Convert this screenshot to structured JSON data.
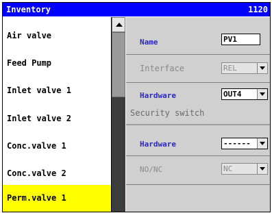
{
  "window": {
    "title": "Inventory",
    "id": "1120"
  },
  "list": {
    "items": [
      {
        "label": "Air valve"
      },
      {
        "label": "Feed Pump"
      },
      {
        "label": "Inlet valve 1"
      },
      {
        "label": "Inlet valve 2"
      },
      {
        "label": "Conc.valve 1"
      },
      {
        "label": "Conc.valve 2"
      },
      {
        "label": "Perm.valve 1"
      }
    ],
    "selected_label": "Perm.valve 1"
  },
  "details": {
    "name_label": "Name",
    "name_value": "PV1",
    "interface_label": "Interface",
    "interface_value": "REL",
    "hardware_label": "Hardware",
    "hardware_value": "OUT4",
    "security_title": "Security switch",
    "sec_hardware_label": "Hardware",
    "sec_hardware_value": "------",
    "nonc_label": "NO/NC",
    "nonc_value": "NC"
  },
  "colors": {
    "titlebar": "#0000ff",
    "selection": "#ffff00",
    "label_blue": "#2a28c8"
  }
}
